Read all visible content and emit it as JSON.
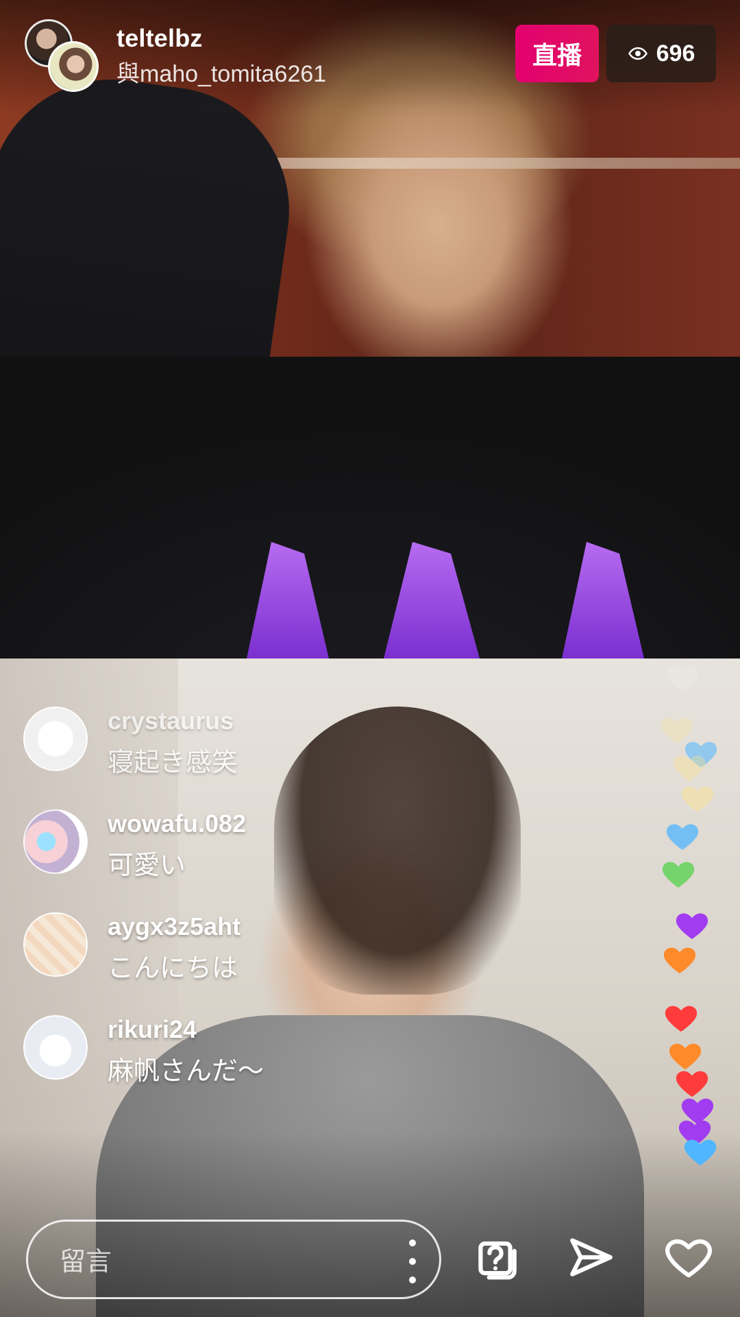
{
  "header": {
    "host_username": "teltelbz",
    "guest_line": "與maho_tomita6261",
    "live_label": "直播",
    "viewer_count": "696"
  },
  "comments": [
    {
      "username": "crystaurus",
      "text": "寝起き感笑"
    },
    {
      "username": "wowafu.082",
      "text": "可愛い"
    },
    {
      "username": "aygx3z5aht",
      "text": "こんにちは"
    },
    {
      "username": "rikuri24",
      "text": "麻帆さんだ〜"
    }
  ],
  "bottom_bar": {
    "comment_placeholder": "留言"
  },
  "colors": {
    "live_badge": "#E3006F",
    "viewer_badge_bg": "#281E19",
    "heart_white": "#FFFFFF",
    "heart_blue": "#4FB6FF",
    "heart_green": "#63D45B",
    "heart_yellow": "#FFE58A",
    "heart_purple": "#A23CF0",
    "heart_orange": "#FF8A2A",
    "heart_red": "#FF3B3B"
  },
  "icons": {
    "viewer": "eye-icon",
    "more": "more-vertical-icon",
    "question": "question-stack-icon",
    "share": "send-icon",
    "like": "heart-outline-icon"
  }
}
